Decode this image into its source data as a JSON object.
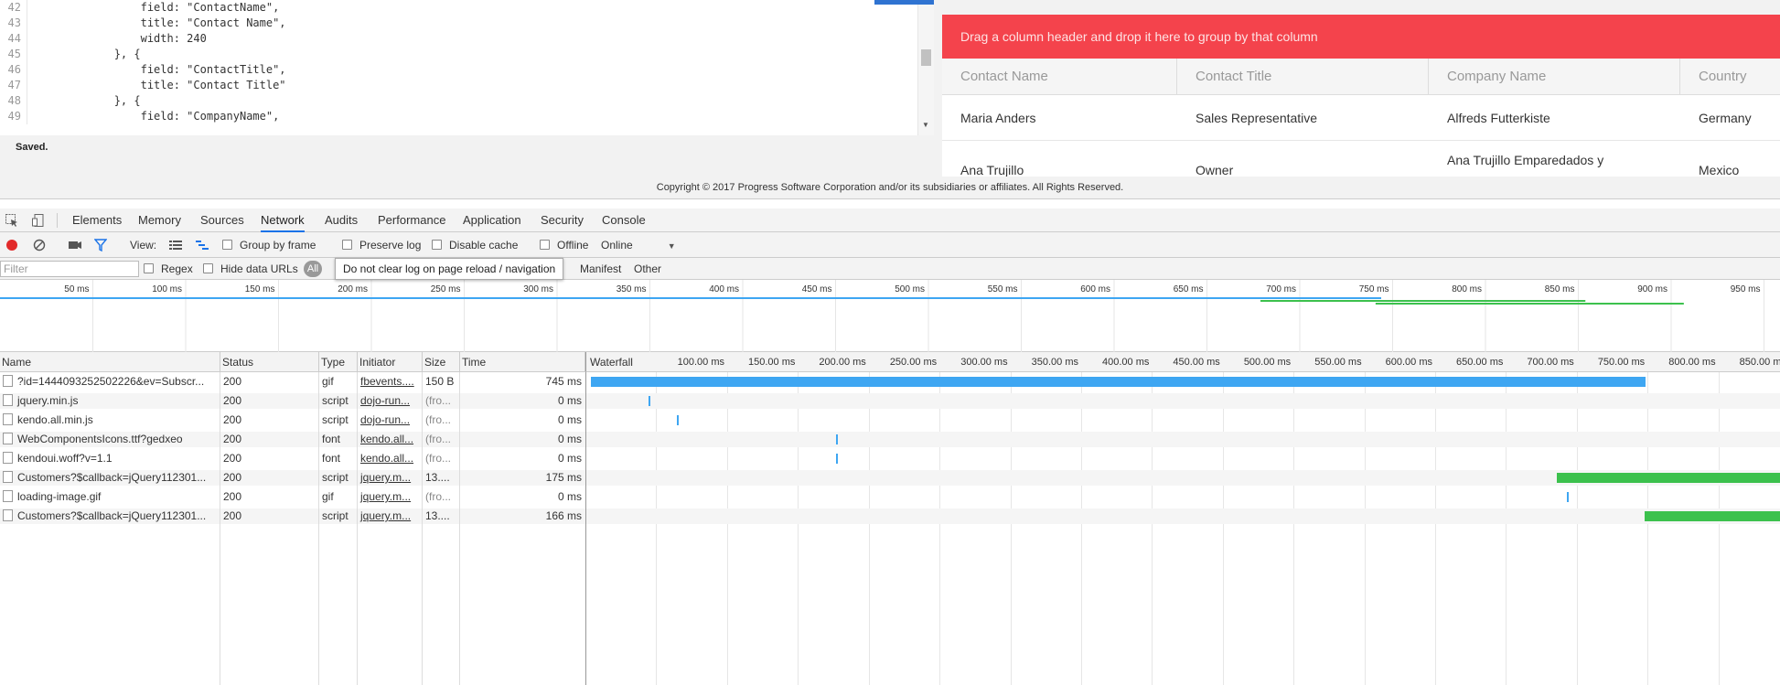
{
  "editor": {
    "lines": [
      {
        "num": "42",
        "code": "                field: \"ContactName\","
      },
      {
        "num": "43",
        "code": "                title: \"Contact Name\","
      },
      {
        "num": "44",
        "code": "                width: 240"
      },
      {
        "num": "45",
        "code": "            }, {"
      },
      {
        "num": "46",
        "code": "                field: \"ContactTitle\","
      },
      {
        "num": "47",
        "code": "                title: \"Contact Title\""
      },
      {
        "num": "48",
        "code": "            }, {"
      },
      {
        "num": "49",
        "code": "                field: \"CompanyName\","
      }
    ],
    "status": "Saved."
  },
  "grid": {
    "group_bar_text": "Drag a column header and drop it here to group by that column",
    "columns": [
      "Contact Name",
      "Contact Title",
      "Company Name",
      "Country"
    ],
    "rows": [
      [
        "Maria Anders",
        "Sales Representative",
        "Alfreds Futterkiste",
        "Germany"
      ],
      [
        "Ana Trujillo",
        "Owner",
        "Ana Trujillo Emparedados y",
        "Mexico"
      ]
    ],
    "colors": {
      "group_bar": "#f4434c"
    }
  },
  "copyright": "Copyright © 2017 Progress Software Corporation and/or its subsidiaries or affiliates. All Rights Reserved.",
  "devtools": {
    "tabs": [
      "Elements",
      "Memory",
      "Sources",
      "Network",
      "Audits",
      "Performance",
      "Application",
      "Security",
      "Console"
    ],
    "active_tab": "Network",
    "toolbar": {
      "view_label": "View:",
      "group_by_frame": "Group by frame",
      "preserve_log": "Preserve log",
      "disable_cache": "Disable cache",
      "offline": "Offline",
      "throttle": "Online"
    },
    "filterbar": {
      "placeholder": "Filter",
      "regex": "Regex",
      "hide_data_urls": "Hide data URLs",
      "all": "All",
      "tooltip": "Do not clear log on page reload / navigation",
      "manifest": "Manifest",
      "other": "Other"
    },
    "overview_ticks": [
      "50 ms",
      "100 ms",
      "150 ms",
      "200 ms",
      "250 ms",
      "300 ms",
      "350 ms",
      "400 ms",
      "450 ms",
      "500 ms",
      "550 ms",
      "600 ms",
      "650 ms",
      "700 ms",
      "750 ms",
      "800 ms",
      "850 ms",
      "900 ms",
      "950 ms"
    ],
    "columns": [
      "Name",
      "Status",
      "Type",
      "Initiator",
      "Size",
      "Time",
      "Waterfall"
    ],
    "waterfall_ticks": [
      "100.00 ms",
      "150.00 ms",
      "200.00 ms",
      "250.00 ms",
      "300.00 ms",
      "350.00 ms",
      "400.00 ms",
      "450.00 ms",
      "500.00 ms",
      "550.00 ms",
      "600.00 ms",
      "650.00 ms",
      "700.00 ms",
      "750.00 ms",
      "800.00 ms",
      "850.00 ms"
    ],
    "requests": [
      {
        "name": "?id=1444093252502226&ev=Subscr...",
        "status": "200",
        "type": "gif",
        "initiator": "fbevents....",
        "size": "150 B",
        "time": "745 ms",
        "wf_start_ms": 0,
        "wf_dur_ms": 745,
        "wf_color": "#3ea6f2"
      },
      {
        "name": "jquery.min.js",
        "status": "200",
        "type": "script",
        "initiator": "dojo-run...",
        "size": "(fro...",
        "time": "0 ms",
        "wf_start_ms": 41,
        "wf_dur_ms": 0,
        "wf_color": "#3ea6f2"
      },
      {
        "name": "kendo.all.min.js",
        "status": "200",
        "type": "script",
        "initiator": "dojo-run...",
        "size": "(fro...",
        "time": "0 ms",
        "wf_start_ms": 61,
        "wf_dur_ms": 0,
        "wf_color": "#3ea6f2"
      },
      {
        "name": "WebComponentsIcons.ttf?gedxeo",
        "status": "200",
        "type": "font",
        "initiator": "kendo.all...",
        "size": "(fro...",
        "time": "0 ms",
        "wf_start_ms": 173,
        "wf_dur_ms": 0,
        "wf_color": "#3ea6f2"
      },
      {
        "name": "kendoui.woff?v=1.1",
        "status": "200",
        "type": "font",
        "initiator": "kendo.all...",
        "size": "(fro...",
        "time": "0 ms",
        "wf_start_ms": 173,
        "wf_dur_ms": 0,
        "wf_color": "#3ea6f2"
      },
      {
        "name": "Customers?$callback=jQuery112301...",
        "status": "200",
        "type": "script",
        "initiator": "jquery.m...",
        "size": "13....",
        "time": "175 ms",
        "wf_start_ms": 682,
        "wf_dur_ms": 175,
        "wf_color": "#3cc14d"
      },
      {
        "name": "loading-image.gif",
        "status": "200",
        "type": "gif",
        "initiator": "jquery.m...",
        "size": "(fro...",
        "time": "0 ms",
        "wf_start_ms": 689,
        "wf_dur_ms": 0,
        "wf_color": "#3ea6f2"
      },
      {
        "name": "Customers?$callback=jQuery112301...",
        "status": "200",
        "type": "script",
        "initiator": "jquery.m...",
        "size": "13....",
        "time": "166 ms",
        "wf_start_ms": 744,
        "wf_dur_ms": 166,
        "wf_color": "#3cc14d"
      }
    ],
    "colors": {
      "accent": "#1a73e8",
      "record": "#e22a2a",
      "filter": "#1a73e8",
      "bar_blue": "#3ea6f2",
      "bar_green": "#3cc14d"
    }
  }
}
